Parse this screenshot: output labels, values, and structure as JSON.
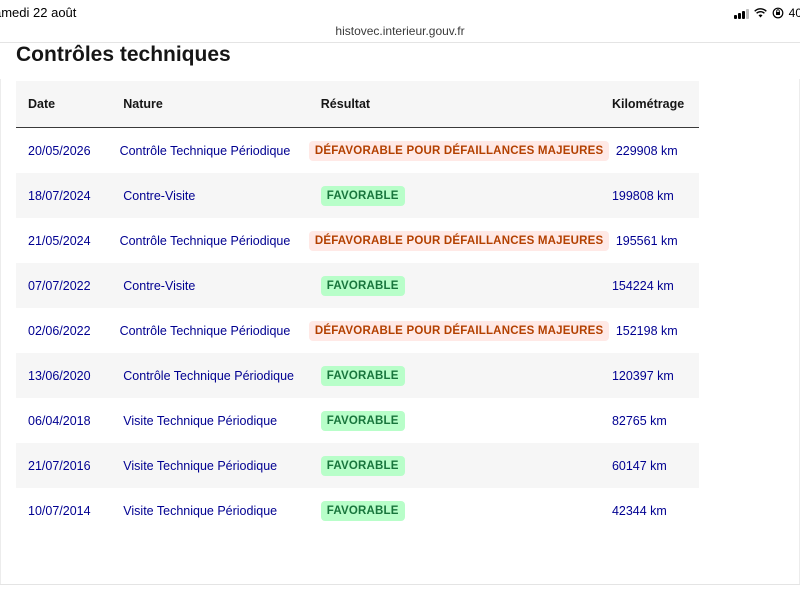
{
  "status_bar": {
    "time": "amedi 22 août",
    "battery": "40"
  },
  "browser": {
    "url": "histovec.interieur.gouv.fr"
  },
  "section": {
    "title": "Contrôles techniques"
  },
  "table": {
    "headers": {
      "date": "Date",
      "nature": "Nature",
      "result": "Résultat",
      "km": "Kilométrage"
    },
    "rows": [
      {
        "date": "20/05/2026",
        "nature": "Contrôle Technique Périodique",
        "result": "DÉFAVORABLE POUR DÉFAILLANCES MAJEURES",
        "result_type": "bad",
        "km": "229908 km"
      },
      {
        "date": "18/07/2024",
        "nature": "Contre-Visite",
        "result": "FAVORABLE",
        "result_type": "ok",
        "km": "199808 km"
      },
      {
        "date": "21/05/2024",
        "nature": "Contrôle Technique Périodique",
        "result": "DÉFAVORABLE POUR DÉFAILLANCES MAJEURES",
        "result_type": "bad",
        "km": "195561 km"
      },
      {
        "date": "07/07/2022",
        "nature": "Contre-Visite",
        "result": "FAVORABLE",
        "result_type": "ok",
        "km": "154224 km"
      },
      {
        "date": "02/06/2022",
        "nature": "Contrôle Technique Périodique",
        "result": "DÉFAVORABLE POUR DÉFAILLANCES MAJEURES",
        "result_type": "bad",
        "km": "152198 km"
      },
      {
        "date": "13/06/2020",
        "nature": "Contrôle Technique Périodique",
        "result": "FAVORABLE",
        "result_type": "ok",
        "km": "120397 km"
      },
      {
        "date": "06/04/2018",
        "nature": "Visite Technique Périodique",
        "result": "FAVORABLE",
        "result_type": "ok",
        "km": "82765 km"
      },
      {
        "date": "21/07/2016",
        "nature": "Visite Technique Périodique",
        "result": "FAVORABLE",
        "result_type": "ok",
        "km": "60147 km"
      },
      {
        "date": "10/07/2014",
        "nature": "Visite Technique Périodique",
        "result": "FAVORABLE",
        "result_type": "ok",
        "km": "42344 km"
      }
    ]
  },
  "colors": {
    "link_blue": "#000091",
    "favorable_bg": "#b8fec9",
    "favorable_text": "#18753c",
    "defavorable_bg": "#ffe9e6",
    "defavorable_text": "#b34000"
  },
  "icons": [
    "cellular-signal-icon",
    "wifi-icon",
    "screen-lock-rotation-icon"
  ]
}
